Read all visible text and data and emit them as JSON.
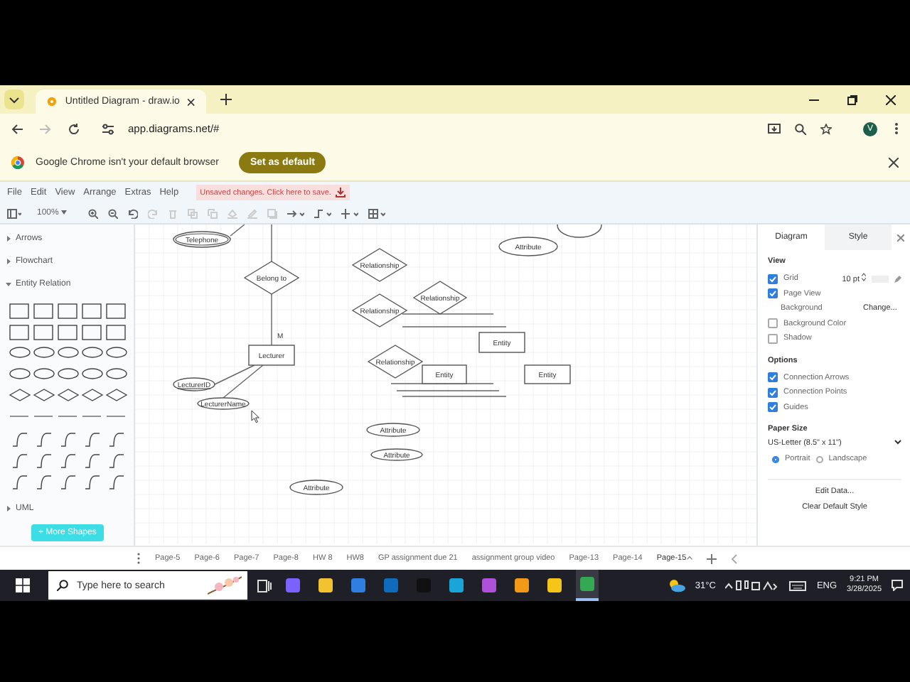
{
  "browser": {
    "tabs": [
      {
        "title": "Untitled Diagram - draw.io",
        "selected": true
      }
    ],
    "url": "app.diagrams.net/#",
    "profile_initial": "V",
    "infobar": {
      "message": "Google Chrome isn't your default browser",
      "button": "Set as default"
    }
  },
  "menu": [
    "File",
    "Edit",
    "View",
    "Arrange",
    "Extras",
    "Help"
  ],
  "save_notice": "Unsaved changes. Click here to save.",
  "toolbar": {
    "zoom": "100%"
  },
  "sidebar": {
    "sections": [
      {
        "label": "Arrows",
        "expanded": false
      },
      {
        "label": "Flowchart",
        "expanded": false
      },
      {
        "label": "Entity Relation",
        "expanded": true
      },
      {
        "label": "UML",
        "expanded": false
      }
    ],
    "more_shapes": "+ More Shapes"
  },
  "diagram": {
    "nodes": [
      {
        "kind": "multivalued",
        "label": "Telephone"
      },
      {
        "kind": "attribute"
      },
      {
        "kind": "attribute",
        "label": "Attribute"
      },
      {
        "kind": "relationship",
        "label": "Belong to"
      },
      {
        "kind": "entity",
        "label": "Lecturer"
      },
      {
        "kind": "key",
        "label": "LecturerID"
      },
      {
        "kind": "attribute",
        "label": "LecturerName"
      },
      {
        "kind": "relationship",
        "label": "Relationship"
      },
      {
        "kind": "relationship",
        "label": "Relationship"
      },
      {
        "kind": "relationship",
        "label": "Relationship"
      },
      {
        "kind": "entity",
        "label": "Entity"
      },
      {
        "kind": "relationship",
        "label": "Relationship"
      },
      {
        "kind": "entity",
        "label": "Entity"
      },
      {
        "kind": "entity",
        "label": "Entity"
      },
      {
        "kind": "attribute",
        "label": "Attribute"
      },
      {
        "kind": "attribute",
        "label": "Attribute"
      },
      {
        "kind": "attribute",
        "label": "Attribute"
      }
    ],
    "edge_label": "M"
  },
  "format_panel": {
    "tabs": [
      {
        "label": "Diagram",
        "selected": true
      },
      {
        "label": "Style",
        "selected": false
      }
    ],
    "view": {
      "heading": "View",
      "options": [
        {
          "kind": "grid",
          "label": "Grid",
          "checked": true,
          "value": "10 pt"
        },
        {
          "kind": "checkbox",
          "label": "Page View",
          "checked": true
        },
        {
          "kind": "background",
          "label": "Background",
          "button": "Change..."
        },
        {
          "kind": "checkbox",
          "label": "Background Color",
          "checked": false
        },
        {
          "kind": "checkbox",
          "label": "Shadow",
          "checked": false
        }
      ]
    },
    "options": {
      "heading": "Options",
      "items": [
        {
          "label": "Connection Arrows",
          "checked": true
        },
        {
          "label": "Connection Points",
          "checked": true
        },
        {
          "label": "Guides",
          "checked": true
        }
      ]
    },
    "paper_size": {
      "heading": "Paper Size",
      "value": "US-Letter (8.5\" x 11\")",
      "orientation": [
        {
          "label": "Portrait",
          "selected": true
        },
        {
          "label": "Landscape",
          "selected": false
        }
      ]
    },
    "buttons": [
      "Edit Data...",
      "Clear Default Style"
    ]
  },
  "pages": [
    {
      "label": "Page-5",
      "selected": false
    },
    {
      "label": "Page-6",
      "selected": false
    },
    {
      "label": "Page-7",
      "selected": false
    },
    {
      "label": "Page-8",
      "selected": false
    },
    {
      "label": "HW 8",
      "selected": false
    },
    {
      "label": "HW8",
      "selected": false
    },
    {
      "label": "GP assignment due 21",
      "selected": false
    },
    {
      "label": "assignment group video",
      "selected": false
    },
    {
      "label": "Page-13",
      "selected": false
    },
    {
      "label": "Page-14",
      "selected": false
    },
    {
      "label": "Page-15",
      "selected": true
    }
  ],
  "taskbar": {
    "search_placeholder": "Type here to search",
    "weather": "31°C",
    "language": "ENG",
    "time": "9:21 PM",
    "date": "3/28/2025",
    "apps": [
      {
        "active": false,
        "color": "#7b61ff"
      },
      {
        "active": false,
        "color": "#f2c230"
      },
      {
        "active": false,
        "color": "#2f7fe0"
      },
      {
        "active": false,
        "color": "#0f6cbd"
      },
      {
        "active": false,
        "color": "#111111"
      },
      {
        "active": false,
        "color": "#1aa5d8"
      },
      {
        "active": false,
        "color": "#b04fd8"
      },
      {
        "active": false,
        "color": "#f29a18"
      },
      {
        "active": false,
        "color": "#f5c518"
      },
      {
        "active": true,
        "color": "#34a853"
      }
    ]
  }
}
